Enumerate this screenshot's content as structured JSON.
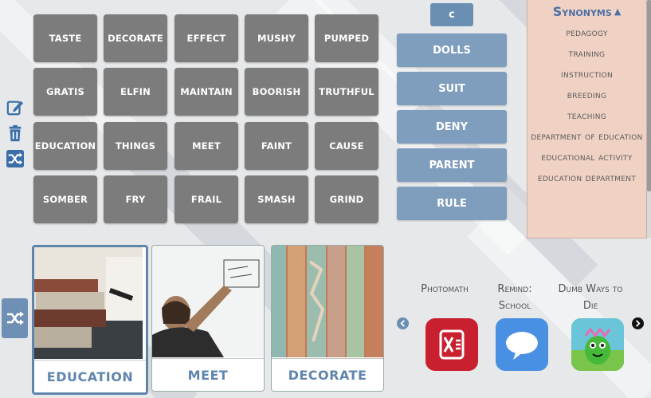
{
  "toolbar": {
    "back_label": "c"
  },
  "word_grid": [
    [
      "taste",
      "decorate",
      "effect",
      "mushy",
      "pumped"
    ],
    [
      "gratis",
      "elfin",
      "maintain",
      "boorish",
      "truthful"
    ],
    [
      "education",
      "things",
      "meet",
      "faint",
      "cause"
    ],
    [
      "somber",
      "fry",
      "frail",
      "smash",
      "grind"
    ]
  ],
  "left_tools": [
    "edit-icon",
    "trash-icon",
    "shuffle-icon"
  ],
  "word_buttons": [
    "dolls",
    "suit",
    "deny",
    "parent",
    "rule"
  ],
  "synonyms": {
    "title": "Synonyms",
    "items": [
      "pedagogy",
      "training",
      "instruction",
      "breeding",
      "teaching",
      "department of education",
      "educational activity",
      "education department"
    ]
  },
  "image_cards": [
    {
      "label": "EDUCATION",
      "selected": true
    },
    {
      "label": "MEET",
      "selected": false
    },
    {
      "label": "DECORATE",
      "selected": false
    }
  ],
  "apps": [
    {
      "name": "Photomath",
      "icon": "photomath-icon",
      "color": "#c8202f"
    },
    {
      "name": "Remind: School",
      "icon": "remind-chat-icon",
      "color": "#4a90e2"
    },
    {
      "name": "Dumb Ways to Die",
      "icon": "dumb-ways-icon",
      "color": "#5cc04a"
    }
  ],
  "colors": {
    "tile": "#7c7c7c",
    "button": "#7f9dbd",
    "accent": "#5f85ad",
    "synonym_bg": "#f0d2c4"
  }
}
